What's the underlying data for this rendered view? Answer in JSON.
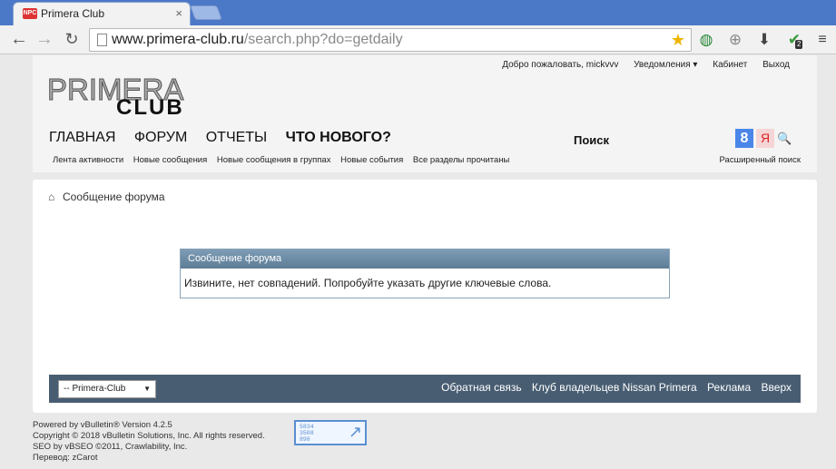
{
  "browser": {
    "tab_title": "Primera Club",
    "tab_favicon": "NPC",
    "tab_close": "×",
    "url_host": "www.primera-club.ru",
    "url_path": "/search.php?do=getdaily",
    "extension_badge": "2"
  },
  "header": {
    "welcome": "Добро пожаловать, mickvvv",
    "notifications": "Уведомления",
    "cabinet": "Кабинет",
    "logout": "Выход",
    "logo_top": "PRIMERA",
    "logo_bottom": "CLUB",
    "nav": [
      {
        "label": "ГЛАВНАЯ"
      },
      {
        "label": "ФОРУМ"
      },
      {
        "label": "ОТЧЕТЫ"
      },
      {
        "label": "ЧТО НОВОГО?"
      }
    ],
    "search_label": "Поиск",
    "subnav": [
      {
        "label": "Лента активности"
      },
      {
        "label": "Новые сообщения"
      },
      {
        "label": "Новые сообщения в группах"
      },
      {
        "label": "Новые события"
      },
      {
        "label": "Все разделы прочитаны"
      }
    ],
    "advanced_search": "Расширенный поиск"
  },
  "content": {
    "breadcrumb": "Сообщение форума",
    "message_title": "Сообщение форума",
    "message_text": "Извините, нет совпадений. Попробуйте указать другие ключевые слова."
  },
  "footer": {
    "style_select": "-- Primera-Club",
    "links": [
      {
        "label": "Обратная связь"
      },
      {
        "label": "Клуб владельцев Nissan Primera"
      },
      {
        "label": "Реклама"
      },
      {
        "label": "Вверх"
      }
    ],
    "credits": [
      "Powered by vBulletin® Version 4.2.5",
      "Copyright © 2018 vBulletin Solutions, Inc. All rights reserved.",
      "SEO by vBSEO ©2011, Crawlability, Inc.",
      "Перевод: zCarot"
    ],
    "counter_lines": [
      "5834",
      "3508",
      "898"
    ]
  }
}
